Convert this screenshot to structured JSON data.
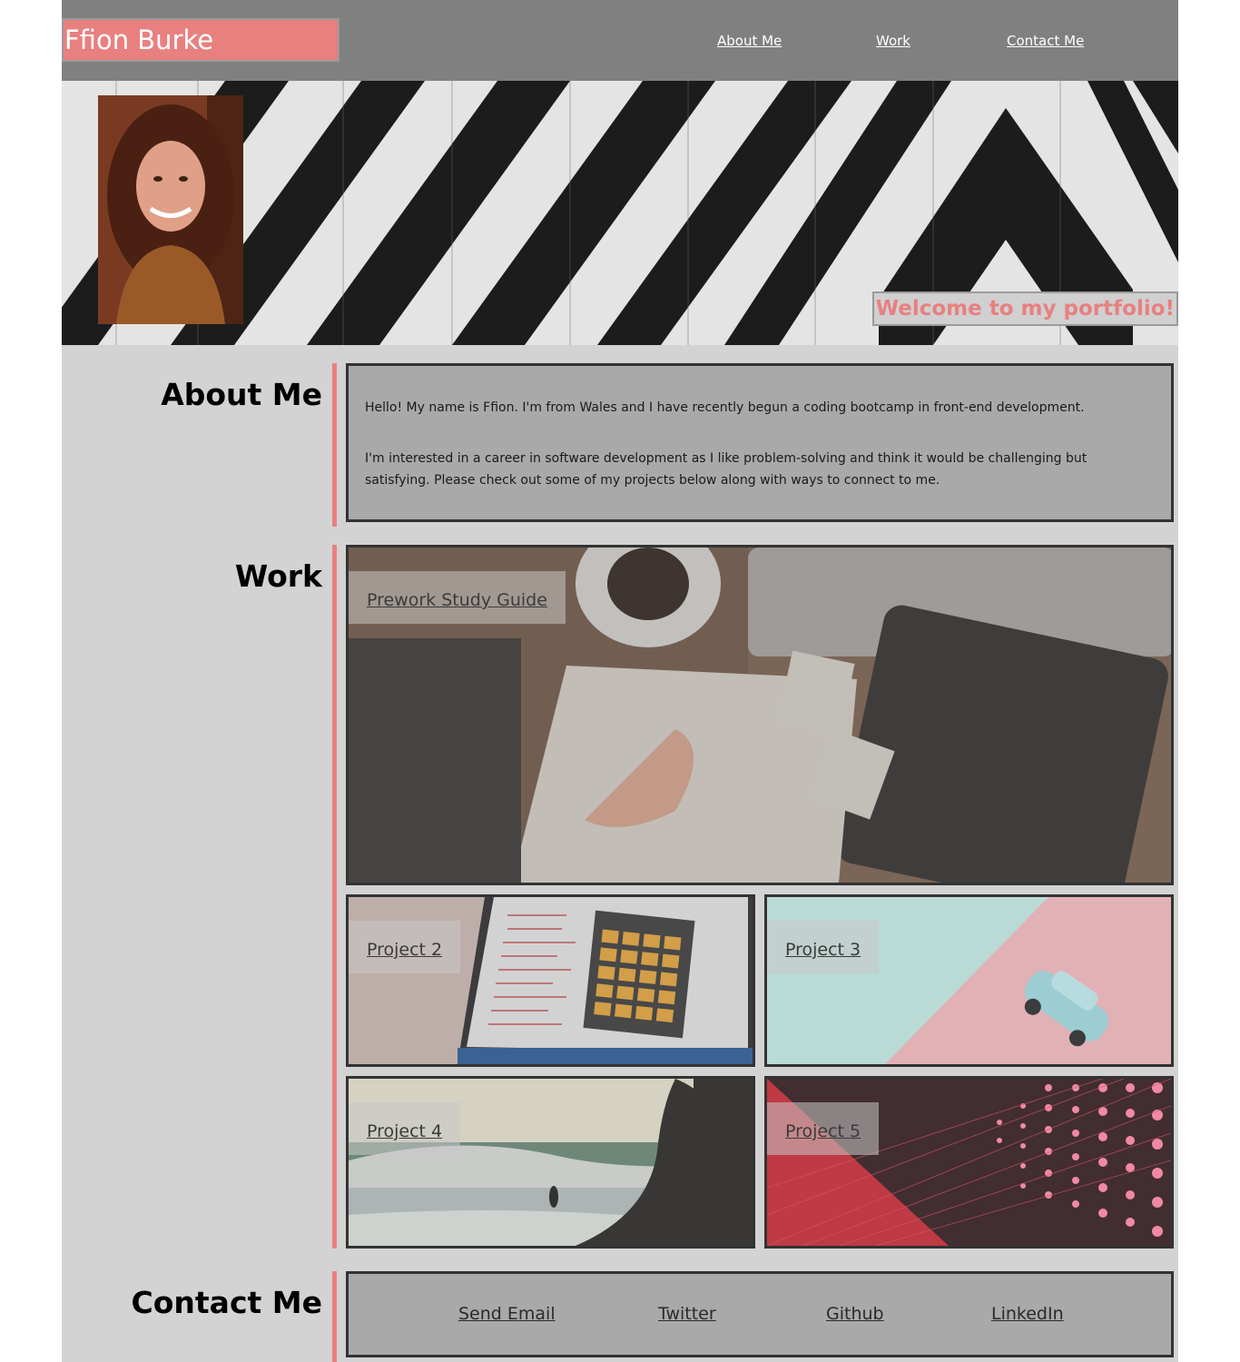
{
  "header": {
    "brand": "Ffion Burke",
    "nav": [
      "About Me",
      "Work",
      "Contact Me"
    ]
  },
  "hero": {
    "welcome": "Welcome to my portfolio!"
  },
  "about": {
    "title": "About Me",
    "paragraphs": [
      "Hello! My name is Ffion. I'm from Wales and I have recently begun a coding bootcamp in front-end development.",
      "I'm interested in a career in software development as I like problem-solving and think it would be challenging but satisfying. Please check out some of my projects below along with ways to connect to me."
    ]
  },
  "work": {
    "title": "Work",
    "projects": [
      "Prework Study Guide",
      "Project 2",
      "Project 3",
      "Project 4",
      "Project 5"
    ]
  },
  "contact": {
    "title": "Contact Me",
    "links": [
      "Send Email",
      "Twitter",
      "Github",
      "LinkedIn"
    ]
  },
  "colors": {
    "accent": "#e88080",
    "header_bg": "#808080",
    "page_bg": "#d3d3d3",
    "box_bg": "#a9a9a9"
  }
}
